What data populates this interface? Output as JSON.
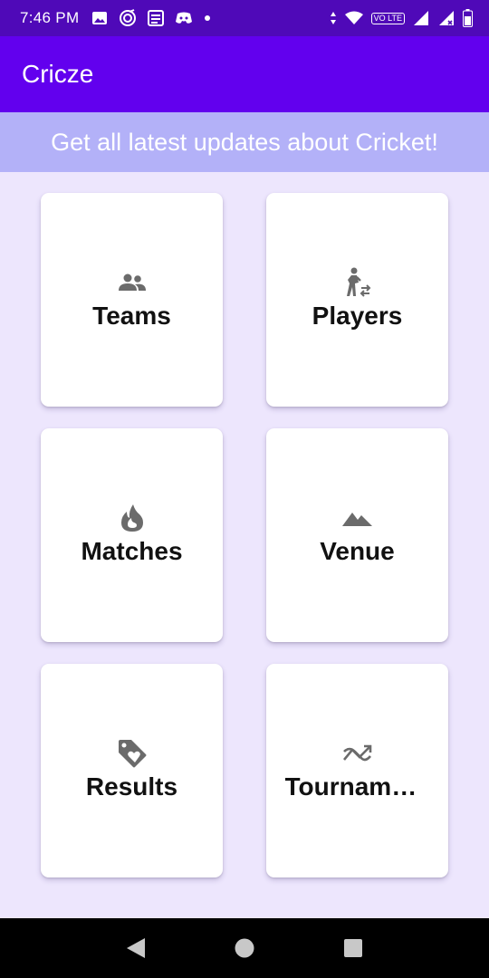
{
  "status_bar": {
    "time": "7:46 PM",
    "left_icons": [
      "image-icon",
      "music-icon",
      "news-icon",
      "discord-icon",
      "dot-icon"
    ],
    "right_icons": [
      "data-arrows-icon",
      "wifi-icon",
      "volte-icon",
      "signal-icon",
      "signal-x-icon",
      "battery-icon"
    ],
    "volte_text": "VO LTE"
  },
  "app_bar": {
    "title": "Cricze"
  },
  "banner": {
    "text": "Get all latest updates about Cricket!"
  },
  "cards": [
    {
      "label": "Teams",
      "icon": "people-icon"
    },
    {
      "label": "Players",
      "icon": "walker-icon"
    },
    {
      "label": "Matches",
      "icon": "flame-icon"
    },
    {
      "label": "Venue",
      "icon": "mountain-icon"
    },
    {
      "label": "Results",
      "icon": "tag-heart-icon"
    },
    {
      "label": "Tournaments",
      "icon": "trend-icon"
    }
  ],
  "nav_bar": {
    "buttons": [
      "back-icon",
      "home-icon",
      "recents-icon"
    ]
  },
  "colors": {
    "status_bar": "#4f09b8",
    "app_bar": "#6200ee",
    "banner": "#b3b1f8",
    "background": "#ede6fd",
    "card": "#ffffff",
    "icon": "#6b6b6b"
  }
}
